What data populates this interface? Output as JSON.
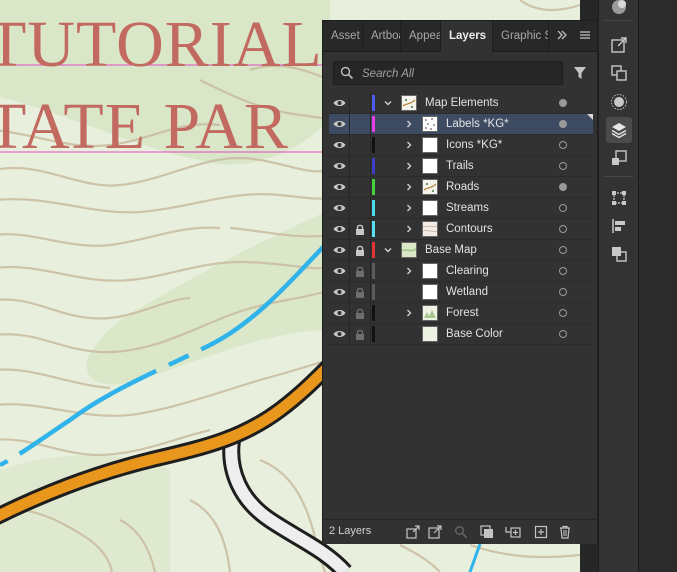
{
  "canvas": {
    "title_line1": "TUTORIAL",
    "title_line2": "TATE PAR",
    "colors": {
      "background": "#e8efdc",
      "forest": "#d9e6c8",
      "contour": "#c9bca0",
      "stream": "#2fb3ea",
      "road": "#e8961c",
      "trail_white": "#eeeeee",
      "title": "#c26a60"
    }
  },
  "panel": {
    "tabs": [
      {
        "label": "Asset",
        "active": false
      },
      {
        "label": "Artboards",
        "active": false
      },
      {
        "label": "Appearance",
        "active": false
      },
      {
        "label": "Layers",
        "active": true
      },
      {
        "label": "Graphic Styles",
        "active": false
      }
    ],
    "overflow_icon": "double-chevron-right-icon",
    "menu_icon": "hamburger-menu-icon",
    "search": {
      "placeholder": "Search All",
      "value": ""
    },
    "filter_icon": "filter-funnel-icon",
    "layers": [
      {
        "name": "Map Elements",
        "level": 0,
        "expanded": true,
        "has_children": true,
        "visible": true,
        "locked": false,
        "lock_dim": false,
        "color": "#4a5cf0",
        "target_filled": true,
        "selected": false,
        "thumb": "mixed"
      },
      {
        "name": "Labels *KG*",
        "level": 1,
        "expanded": false,
        "has_children": true,
        "visible": true,
        "locked": false,
        "lock_dim": false,
        "color": "#e63de6",
        "target_filled": true,
        "selected": true,
        "thumb": "dots"
      },
      {
        "name": "Icons *KG*",
        "level": 1,
        "expanded": false,
        "has_children": true,
        "visible": true,
        "locked": false,
        "lock_dim": false,
        "color": "#111111",
        "target_filled": false,
        "selected": false,
        "thumb": "blank"
      },
      {
        "name": "Trails",
        "level": 1,
        "expanded": false,
        "has_children": true,
        "visible": true,
        "locked": false,
        "lock_dim": false,
        "color": "#3d3dc8",
        "target_filled": false,
        "selected": false,
        "thumb": "blank"
      },
      {
        "name": "Roads",
        "level": 1,
        "expanded": false,
        "has_children": true,
        "visible": true,
        "locked": false,
        "lock_dim": false,
        "color": "#45d13d",
        "target_filled": true,
        "selected": false,
        "thumb": "mixed"
      },
      {
        "name": "Streams",
        "level": 1,
        "expanded": false,
        "has_children": true,
        "visible": true,
        "locked": false,
        "lock_dim": false,
        "color": "#4adcec",
        "target_filled": false,
        "selected": false,
        "thumb": "blank"
      },
      {
        "name": "Contours",
        "level": 1,
        "expanded": false,
        "has_children": true,
        "visible": true,
        "locked": true,
        "lock_dim": false,
        "color": "#55e0f2",
        "target_filled": false,
        "selected": false,
        "thumb": "contour"
      },
      {
        "name": "Base Map",
        "level": 0,
        "expanded": true,
        "has_children": true,
        "visible": true,
        "locked": true,
        "lock_dim": false,
        "color": "#e03535",
        "target_filled": false,
        "selected": false,
        "thumb": "map"
      },
      {
        "name": "Clearing",
        "level": 1,
        "expanded": false,
        "has_children": true,
        "visible": true,
        "locked": true,
        "lock_dim": true,
        "color": "#5a5a5a",
        "target_filled": false,
        "selected": false,
        "thumb": "blank"
      },
      {
        "name": "Wetland",
        "level": 1,
        "expanded": false,
        "has_children": false,
        "visible": true,
        "locked": true,
        "lock_dim": true,
        "color": "#5a5a5a",
        "target_filled": false,
        "selected": false,
        "thumb": "blank"
      },
      {
        "name": "Forest",
        "level": 1,
        "expanded": false,
        "has_children": true,
        "visible": true,
        "locked": true,
        "lock_dim": true,
        "color": "#111111",
        "target_filled": false,
        "selected": false,
        "thumb": "forest"
      },
      {
        "name": "Base Color",
        "level": 1,
        "expanded": false,
        "has_children": false,
        "visible": true,
        "locked": true,
        "lock_dim": true,
        "color": "#111111",
        "target_filled": false,
        "selected": false,
        "thumb": "pale"
      }
    ],
    "footer": {
      "layer_count": "2 Layers",
      "buttons": [
        {
          "name": "collect-for-export-icon"
        },
        {
          "name": "locate-object-icon"
        },
        {
          "name": "search-icon"
        },
        {
          "name": "make-clipping-mask-icon"
        },
        {
          "name": "create-sublayer-icon"
        },
        {
          "name": "create-new-layer-icon"
        },
        {
          "name": "trash-icon"
        }
      ]
    }
  },
  "toolbar": {
    "icons": [
      "color-guide-icon",
      "export-icon",
      "arrange-icon",
      "appearance-sun-icon",
      "layers-icon",
      "asset-export-icon",
      "transform-icon",
      "align-icon",
      "pathfinder-icon"
    ],
    "active": "layers-icon"
  }
}
